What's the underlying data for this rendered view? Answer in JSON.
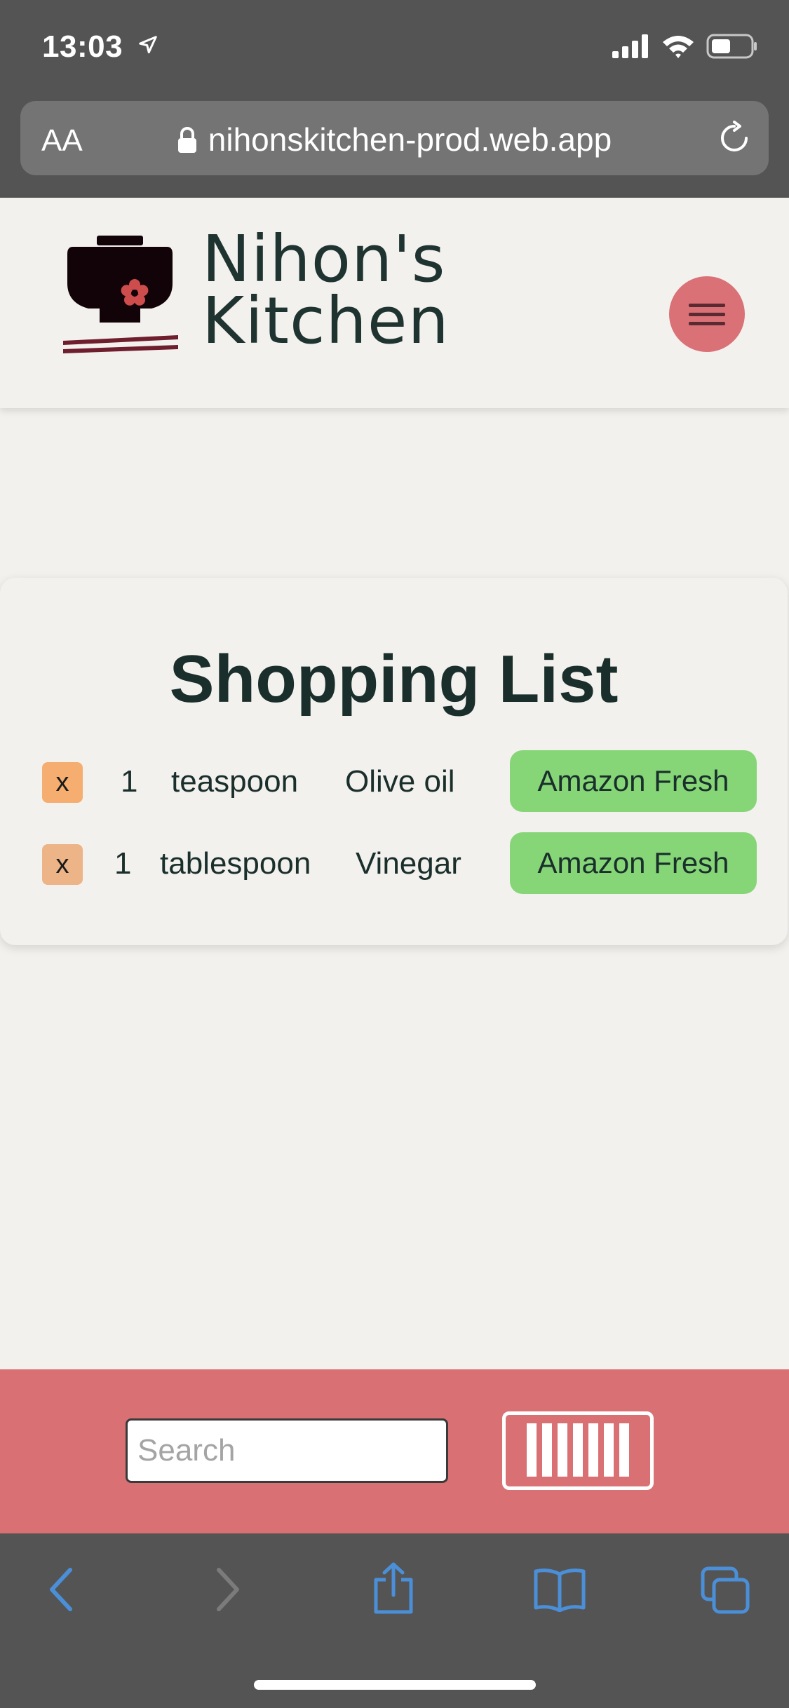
{
  "status_bar": {
    "time": "13:03",
    "icons": [
      "location-arrow-icon",
      "cellular-signal-icon",
      "wifi-icon",
      "battery-icon"
    ]
  },
  "browser": {
    "text_size_label": "AA",
    "url": "nihonskitchen-prod.web.app",
    "icons": [
      "lock-icon",
      "reload-icon"
    ]
  },
  "header": {
    "brand_line1": "Nihon's",
    "brand_line2": "Kitchen",
    "menu_icon": "hamburger-menu-icon"
  },
  "shopping_list": {
    "title": "Shopping List",
    "remove_label": "x",
    "items": [
      {
        "quantity": "1",
        "unit": "teaspoon",
        "name": "Olive oil",
        "store": "Amazon Fresh",
        "remove_color": "#f5ae6f"
      },
      {
        "quantity": "1",
        "unit": "tablespoon",
        "name": "Vinegar",
        "store": "Amazon Fresh",
        "remove_color": "#ecb487"
      }
    ]
  },
  "bottom_bar": {
    "search_placeholder": "Search",
    "search_value": "",
    "barcode_icon": "barcode-scanner-icon"
  },
  "toolbar": {
    "icons": [
      "back-icon",
      "forward-icon",
      "share-icon",
      "bookmarks-icon",
      "tabs-icon"
    ]
  },
  "colors": {
    "accent": "#d97074",
    "store_button": "#86d677",
    "text": "#1a2f2c",
    "page_bg": "#f3f1ee",
    "browser_chrome": "#545454",
    "toolbar_icon_active": "#4a8fd8",
    "toolbar_icon_disabled": "#7b7b7b"
  }
}
